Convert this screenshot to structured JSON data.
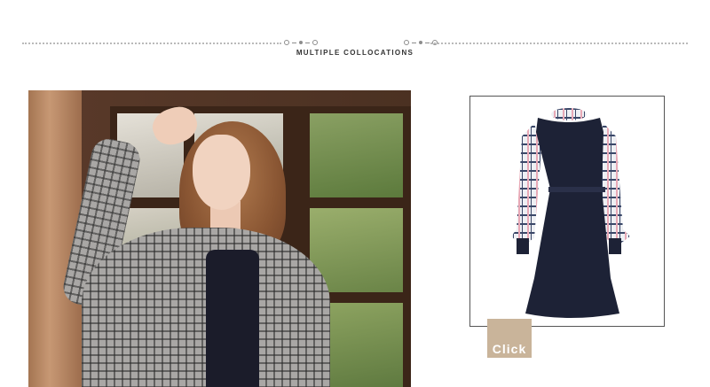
{
  "header": {
    "title": "MULTIPLE COLLOCATIONS"
  },
  "photo": {
    "description_icon": "model-photo"
  },
  "product": {
    "icon": "dress-thumbnail",
    "click_label": "Click"
  }
}
